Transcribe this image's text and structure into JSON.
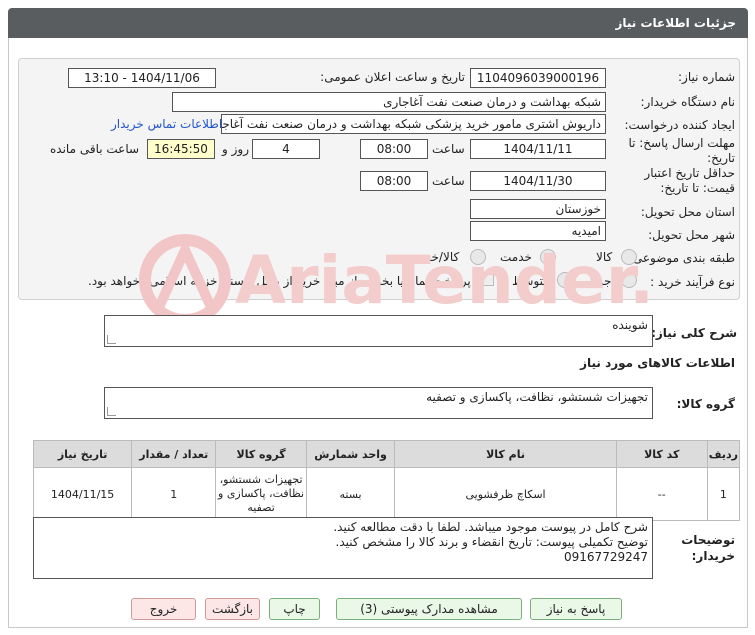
{
  "header": {
    "title": "جزئیات اطلاعات نیاز"
  },
  "fields": {
    "need_number_label": "شماره نیاز:",
    "need_number": "1104096039000196",
    "announce_label": "تاریخ و ساعت اعلان عمومی:",
    "announce_value": "1404/11/06 - 13:10",
    "buyer_label": "نام دستگاه خریدار:",
    "buyer_value": "شبکه بهداشت و درمان صنعت نفت آغاجاری",
    "creator_label": "ایجاد کننده درخواست:",
    "creator_value": "داریوش اشتری مامور خرید پزشکی شبکه بهداشت و درمان صنعت نفت آغاجاری",
    "contact_link": "اطلاعات تماس خریدار",
    "reply_label_1": "مهلت ارسال پاسخ: تا",
    "reply_label_2": "تاریخ:",
    "reply_date": "1404/11/11",
    "time_label": "ساعت",
    "reply_time": "08:00",
    "days_value": "4",
    "days_label": "روز و",
    "remaining_time": "16:45:50",
    "remaining_label": "ساعت باقی مانده",
    "validity_label_1": "حداقل تاریخ اعتبار",
    "validity_label_2": "قیمت: تا تاریخ:",
    "validity_date": "1404/11/30",
    "validity_time_label": "ساعت",
    "validity_time": "08:00",
    "province_label": "استان محل تحویل:",
    "province_value": "خوزستان",
    "city_label": "شهر محل تحویل:",
    "city_value": "امیدیه",
    "category_label": "طبقه بندی موضوعی:",
    "category_options": [
      "کالا",
      "خدمت",
      "کالا/خدمت"
    ],
    "process_label": "نوع فرآیند خرید :",
    "process_options": [
      "جزیی",
      "متوسط"
    ],
    "payment_note": "پرداخت تمام یا بخشی از مبلغ خرید،از محل \"اسناد خزانه اسلامی\" خواهد بود."
  },
  "summary": {
    "label": "شرح کلی نیاز:",
    "value": "شوینده"
  },
  "goods_section": {
    "title": "اطلاعات کالاهای مورد نیاز",
    "group_label": "گروه کالا:",
    "group_value": "تجهیزات شستشو، نظافت، پاکسازی و تصفیه"
  },
  "table": {
    "headers": [
      "ردیف",
      "کد کالا",
      "نام کالا",
      "واحد شمارش",
      "گروه کالا",
      "تعداد / مقدار",
      "تاریخ نیاز"
    ],
    "rows": [
      [
        "1",
        "--",
        "اسکاچ ظرفشویی",
        "بسته",
        "تجهیزات شستشو، نظافت، پاکسازی و تصفیه",
        "1",
        "1404/11/15"
      ]
    ]
  },
  "buyer_notes": {
    "label_1": "توضیحات",
    "label_2": "خریدار:",
    "lines": [
      "شرح کامل در پیوست موجود میباشد. لطفا با دقت مطالعه کنید.",
      "توضیح تکمیلی پیوست: تاریخ انقضاء و برند کالا را مشخص کنید.",
      "09167729247"
    ]
  },
  "buttons": {
    "reply": "پاسخ به نیاز",
    "docs": "مشاهده مدارک پیوستی (3)",
    "print": "چاپ",
    "back": "بازگشت",
    "exit": "خروج"
  },
  "watermark": {
    "text": "AriaTender.neT"
  },
  "colors": {
    "title_bg": "#5a5d60",
    "yellow_box": "#ffffcc",
    "button_green": "#eaf8e8",
    "button_pink": "#fde6e6",
    "link": "#2255cc"
  }
}
